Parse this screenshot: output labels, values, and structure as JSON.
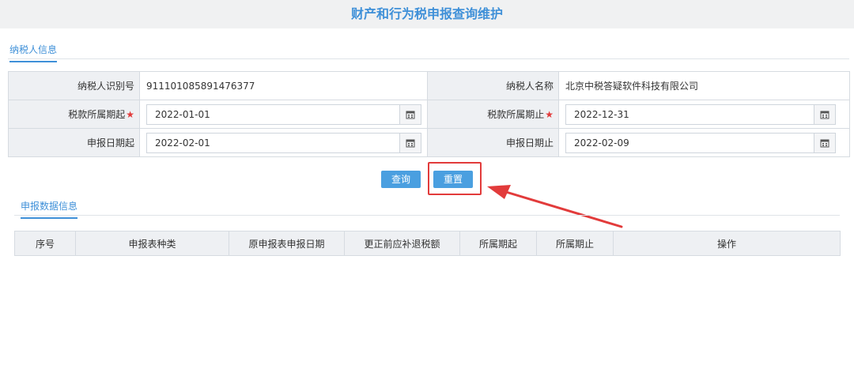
{
  "page": {
    "title": "财产和行为税申报查询维护"
  },
  "taxpayer_section": {
    "tab_label": "纳税人信息"
  },
  "form": {
    "taxpayer_id_label": "纳税人识别号",
    "taxpayer_id_value": "911101085891476377",
    "taxpayer_name_label": "纳税人名称",
    "taxpayer_name_value": "北京中税答疑软件科技有限公司",
    "period_start_label": "税款所属期起",
    "period_start_value": "2022-01-01",
    "period_end_label": "税款所属期止",
    "period_end_value": "2022-12-31",
    "filing_start_label": "申报日期起",
    "filing_start_value": "2022-02-01",
    "filing_end_label": "申报日期止",
    "filing_end_value": "2022-02-09",
    "required_mark": "★"
  },
  "actions": {
    "query_label": "查询",
    "reset_label": "重置"
  },
  "data_section": {
    "tab_label": "申报数据信息",
    "columns": [
      "序号",
      "申报表种类",
      "原申报表申报日期",
      "更正前应补退税额",
      "所属期起",
      "所属期止",
      "操作"
    ]
  },
  "colors": {
    "accent": "#3f90d8",
    "button": "#4a9fe0",
    "annotation": "#e23b3b"
  },
  "icons": {
    "calendar": "calendar-icon"
  }
}
